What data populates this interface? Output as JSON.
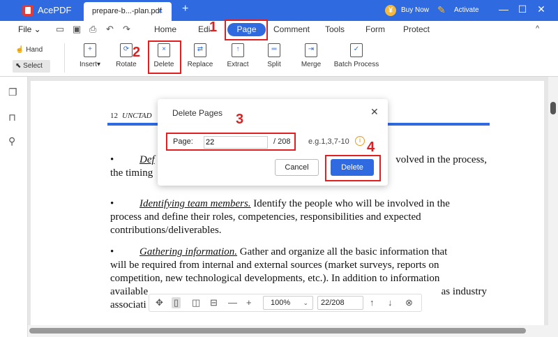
{
  "titlebar": {
    "app_name": "AcePDF",
    "doc_tab": "prepare-b...-plan.pdf",
    "tab_close": "×",
    "new_tab": "+",
    "buy_now": "Buy Now",
    "activate": "Activate",
    "minimize": "—",
    "maximize": "☐",
    "close": "✕"
  },
  "menu": {
    "file": "File",
    "quick_actions": [
      "open-icon",
      "save-icon",
      "print-icon",
      "undo-icon",
      "redo-icon"
    ],
    "tabs": [
      "Home",
      "Edi",
      "Page",
      "Comment",
      "Tools",
      "Form",
      "Protect"
    ],
    "active_tab": "Page"
  },
  "ribbon": {
    "hand": "Hand",
    "select": "Select",
    "tools": [
      "Insert",
      "Rotate",
      "Delete",
      "Replace",
      "Extract",
      "Split",
      "Merge",
      "Batch Process"
    ]
  },
  "document": {
    "header_num": "12",
    "header_text": "UNCTAD",
    "para1": {
      "term": "Def",
      "line1_right": "volved in the process,",
      "line2": "the timing"
    },
    "para2": {
      "term": "Identifying team members.",
      "line1_rest": " Identify the people who will be involved in the",
      "line2": "process and define their roles, competencies, responsibilities and expected",
      "line3": "contributions/deliverables."
    },
    "para3": {
      "term": "Gathering information.",
      "line1_rest": " Gather and organize all the basic information that",
      "line2": "will be required from internal and external sources (market surveys, reports on",
      "line3": "competition, new technological developments, etc.). In addition to information",
      "line4_left": "available",
      "line4_right": "as industry",
      "line5": "associati"
    }
  },
  "bottombar": {
    "zoom": "100%",
    "page": "22/208"
  },
  "dialog": {
    "title": "Delete Pages",
    "page_label": "Page:",
    "page_value": "22",
    "page_total": "/ 208",
    "hint": "e.g.1,3,7-10",
    "cancel": "Cancel",
    "delete": "Delete"
  },
  "annotations": [
    "1",
    "2",
    "3",
    "4"
  ],
  "colors": {
    "brand": "#2f6ae0",
    "annotation": "#e02020"
  }
}
